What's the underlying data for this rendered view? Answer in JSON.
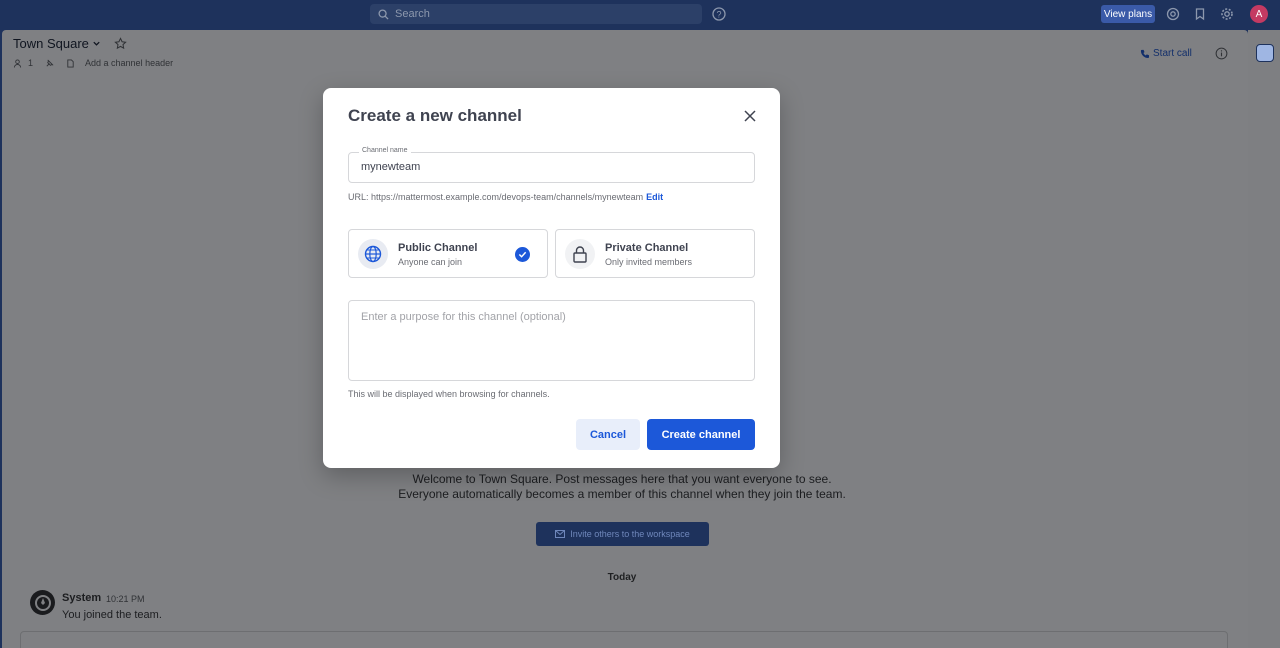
{
  "topbar": {
    "search_placeholder": "Search",
    "view_plans_label": "View plans",
    "avatar_initial": "A"
  },
  "channel": {
    "title": "Town Square",
    "member_count": "1",
    "add_header_label": "Add a channel header",
    "start_call_label": "Start call"
  },
  "background": {
    "welcome_text": "Welcome to Town Square. Post messages here that you want everyone to see. Everyone automatically becomes a member of this channel when they join the team.",
    "invite_label": "Invite others to the workspace",
    "date_separator": "Today",
    "post": {
      "author": "System",
      "time": "10:21 PM",
      "message": "You joined the team."
    }
  },
  "modal": {
    "title": "Create a new channel",
    "channel_name_label": "Channel name",
    "channel_name_value": "mynewteam",
    "url_prefix": "URL: https://mattermost.example.com/devops-team/channels/mynewteam",
    "url_edit_label": "Edit",
    "public": {
      "name": "Public Channel",
      "description": "Anyone can join",
      "selected": true
    },
    "private": {
      "name": "Private Channel",
      "description": "Only invited members",
      "selected": false
    },
    "purpose_placeholder": "Enter a purpose for this channel (optional)",
    "purpose_help": "This will be displayed when browsing for channels.",
    "cancel_label": "Cancel",
    "create_label": "Create channel"
  },
  "colors": {
    "accent": "#1c58d9",
    "topbar_bg": "#1e325c",
    "overlay_bg": "#7f8083"
  }
}
